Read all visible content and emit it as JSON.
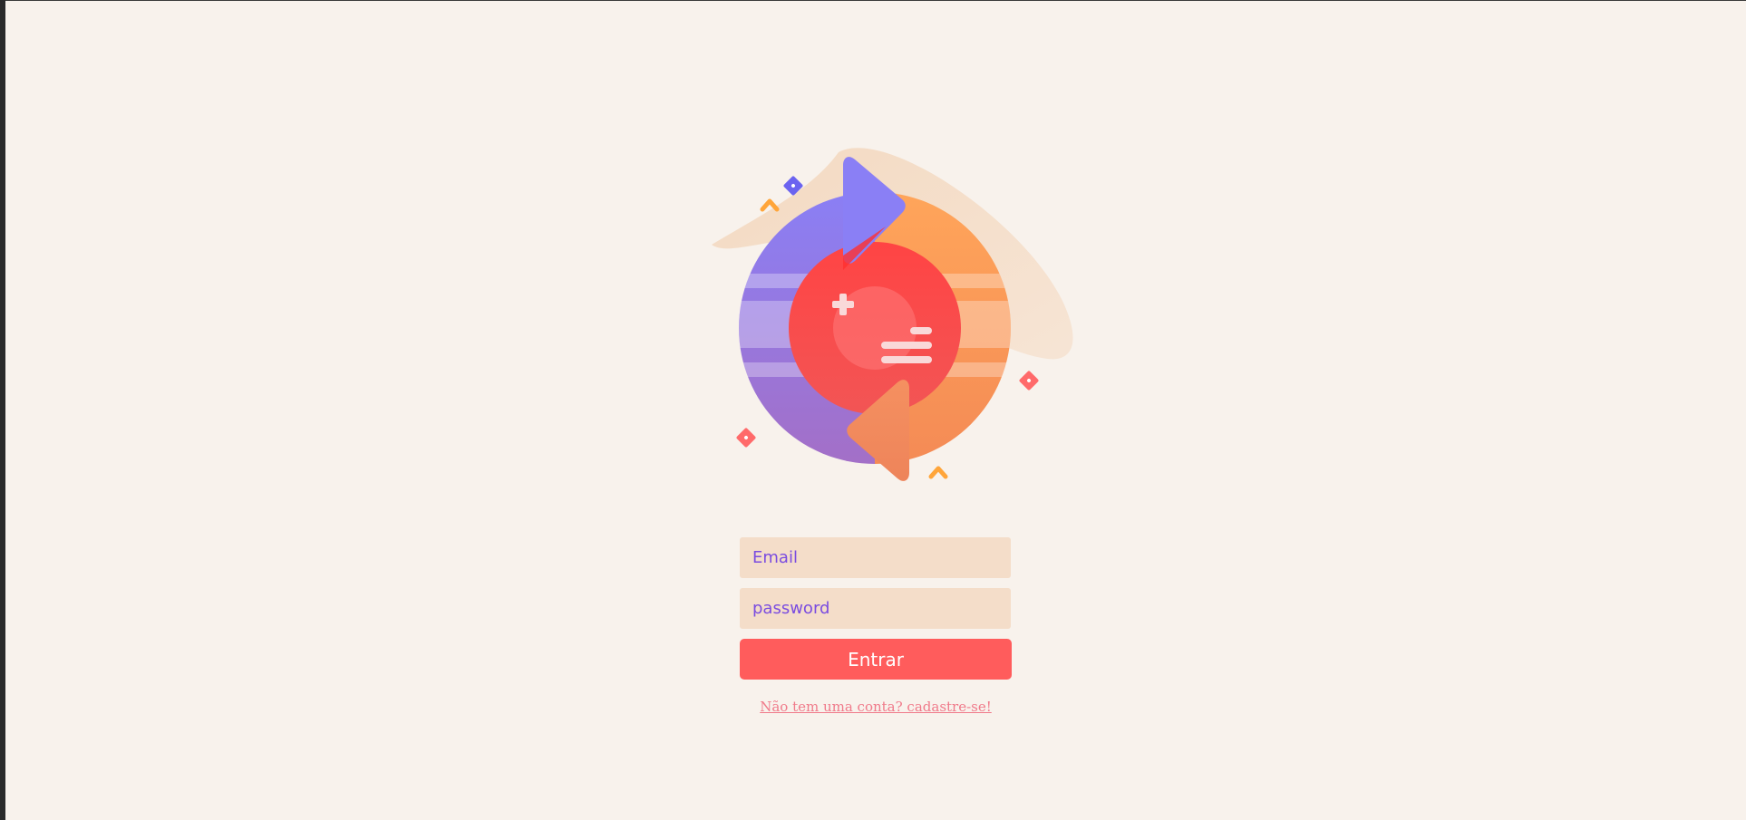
{
  "login": {
    "email_placeholder": "Email",
    "password_placeholder": "password",
    "submit_label": "Entrar",
    "signup_link": "Não tem uma conta? cadastre-se!"
  },
  "colors": {
    "background": "#f8f2ec",
    "input_background": "#f4ddc9",
    "input_text": "#7a4ce0",
    "button": "#ff5c5c",
    "link": "#f07a8a"
  },
  "icons": {
    "logo": "sync-circular-arrows-icon"
  }
}
